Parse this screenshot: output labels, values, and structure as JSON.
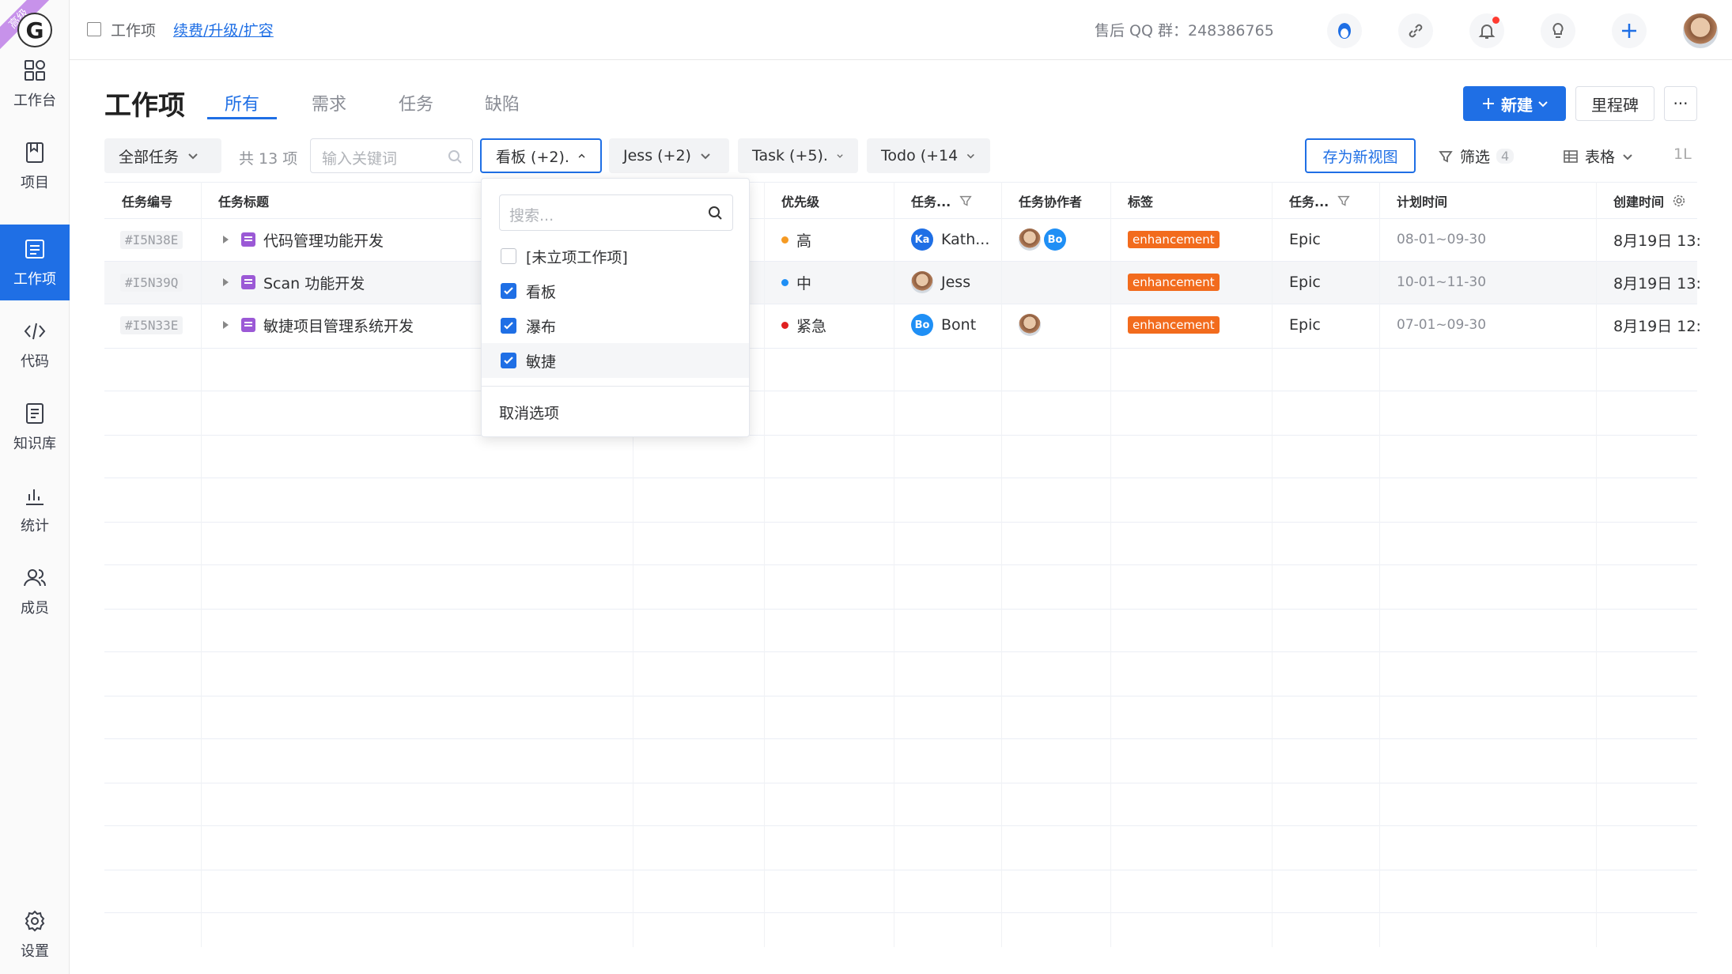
{
  "sidebar": {
    "ribbon": "高级",
    "logo": "G",
    "items": [
      {
        "label": "工作台",
        "icon": "dashboard-icon"
      },
      {
        "label": "项目",
        "icon": "project-icon"
      },
      {
        "label": "工作项",
        "icon": "workitem-icon"
      },
      {
        "label": "代码",
        "icon": "code-icon"
      },
      {
        "label": "知识库",
        "icon": "knowledge-icon"
      },
      {
        "label": "统计",
        "icon": "chart-icon"
      },
      {
        "label": "成员",
        "icon": "members-icon"
      }
    ],
    "settings": "设置"
  },
  "header": {
    "breadcrumb": "工作项",
    "renew_link": "续费/升级/扩容",
    "qq_group": "售后 QQ 群：248386765"
  },
  "page": {
    "title": "工作项",
    "tabs": [
      "所有",
      "需求",
      "任务",
      "缺陷"
    ],
    "new_button": "新建",
    "milestone_button": "里程碑",
    "more_button": "···"
  },
  "filters": {
    "scope": "全部任务",
    "count": "共 13 项",
    "keyword_placeholder": "输入关键词",
    "project": "看板 (+2).",
    "assignee": "Jess (+2)",
    "type": "Task (+5).",
    "status": "Todo (+14",
    "save_view": "存为新视图",
    "filter": "筛选",
    "filter_count": "4",
    "view": "表格",
    "sort": "1L"
  },
  "table": {
    "columns": [
      "任务编号",
      "任务标题",
      "优先级",
      "任务...",
      "任务协作者",
      "标签",
      "任务...",
      "计划时间",
      "创建时间"
    ],
    "rows": [
      {
        "id": "#I5N38E",
        "title": "代码管理功能开发",
        "priority": "高",
        "priority_color": "#f59a23",
        "assignee": "Kath...",
        "assignee_initials": "Ka",
        "assignee_color": "#1f6fe5",
        "collab_initials": "Bo",
        "tag": "enhancement",
        "type": "Epic",
        "plan": "08-01~09-30",
        "created": "8月19日 13:"
      },
      {
        "id": "#I5N39Q",
        "title": "Scan 功能开发",
        "priority": "中",
        "priority_color": "#1f8ff5",
        "assignee": "Jess",
        "assignee_initials": "",
        "assignee_color": "",
        "collab_initials": "",
        "tag": "enhancement",
        "type": "Epic",
        "plan": "10-01~11-30",
        "created": "8月19日 13:"
      },
      {
        "id": "#I5N33E",
        "title": "敏捷项目管理系统开发",
        "priority": "紧急",
        "priority_color": "#e02020",
        "assignee": "Bont",
        "assignee_initials": "Bo",
        "assignee_color": "#1f8ff5",
        "collab_initials": "",
        "tag": "enhancement",
        "type": "Epic",
        "plan": "07-01~09-30",
        "created": "8月19日 12:"
      }
    ]
  },
  "dropdown": {
    "search_placeholder": "搜索...",
    "options": [
      {
        "label": "[未立项工作项]",
        "checked": false
      },
      {
        "label": "看板",
        "checked": true
      },
      {
        "label": "瀑布",
        "checked": true
      },
      {
        "label": "敏捷",
        "checked": true
      }
    ],
    "cancel": "取消选项"
  },
  "colors": {
    "accent": "#1f6fe5",
    "tag": "#f26b1d"
  }
}
